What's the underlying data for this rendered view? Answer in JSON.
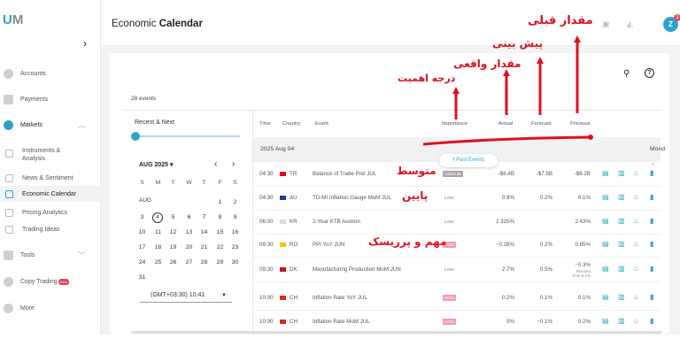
{
  "app": {
    "logo_a": "U",
    "logo_b": "M"
  },
  "header": {
    "title_prefix": "Economic",
    "title_bold": "Calendar",
    "avatar_initial": "Z",
    "notif_count": "1"
  },
  "sidebar": {
    "items": [
      {
        "label": "Accounts"
      },
      {
        "label": "Payments"
      },
      {
        "label": "Markets"
      },
      {
        "label": "Instruments &\nAnalysis"
      },
      {
        "label": "News & Sentiment"
      },
      {
        "label": "Economic Calendar"
      },
      {
        "label": "Pricing Analytics"
      },
      {
        "label": "Trading Ideas"
      },
      {
        "label": "Tools"
      },
      {
        "label": "Copy Trading"
      },
      {
        "label": "More"
      }
    ],
    "new_badge": "New"
  },
  "panel": {
    "events_count": "28 events",
    "recent_label": "Recent & Next",
    "month_label": "AUG 2025",
    "month_short": "AUG",
    "weekdays": [
      "S",
      "M",
      "T",
      "W",
      "T",
      "F",
      "S"
    ],
    "timezone": "(GMT+03:30) 10:41"
  },
  "table": {
    "headers": {
      "time": "Time",
      "country": "Country",
      "event": "Event",
      "importance": "Importance",
      "actual": "Actual",
      "forecast": "Forecast",
      "previous": "Previous"
    },
    "date_label": "2025 Aug 04",
    "next_date_label": "Mond",
    "past_events_label": "Past Events",
    "revised_label": "Revised from",
    "rows": [
      {
        "time": "04:30",
        "country": "TR",
        "event": "Balance of Trade Prel JUL",
        "importance": "MEDIUM",
        "level": "medium",
        "actual": "-$6.4B",
        "forecast": "-$7.5B",
        "previous": "-$8.2B",
        "revised": "",
        "flag": "#e30a17"
      },
      {
        "time": "04:30",
        "country": "AU",
        "event": "TD-MI Inflation Gauge MoM JUL",
        "importance": "LOW",
        "level": "low",
        "actual": "0.9%",
        "forecast": "0.2%",
        "previous": "0.1%",
        "revised": "",
        "flag": "#1d3f8a"
      },
      {
        "time": "06:00",
        "country": "KR",
        "event": "2-Year KTB Auction",
        "importance": "LOW",
        "level": "low",
        "actual": "2.325%",
        "forecast": "",
        "previous": "2.43%",
        "revised": "",
        "flag": "#dcdcdc"
      },
      {
        "time": "09:30",
        "country": "RO",
        "event": "PPI YoY JUN",
        "importance": "HIGH",
        "level": "high",
        "actual": "−0.28%",
        "forecast": "0.2%",
        "previous": "0.85%",
        "revised": "",
        "flag": "#f7c600"
      },
      {
        "time": "09:30",
        "country": "DK",
        "event": "Manufacturing Production MoM JUN",
        "importance": "LOW",
        "level": "low",
        "actual": "2.7%",
        "forecast": "0.5%",
        "previous": "−0.3%",
        "revised": "0.1%",
        "flag": "#c8102e"
      },
      {
        "time": "10:00",
        "country": "CH",
        "event": "Inflation Rate YoY JUL",
        "importance": "HIGH",
        "level": "high",
        "actual": "0.2%",
        "forecast": "0.1%",
        "previous": "0.1%",
        "revised": "",
        "flag": "#d52b1e"
      },
      {
        "time": "10:00",
        "country": "CH",
        "event": "Inflation Rate MoM JUL",
        "importance": "HIGH",
        "level": "high",
        "actual": "0%",
        "forecast": "−0.1%",
        "previous": "0.2%",
        "revised": "",
        "flag": "#d52b1e"
      }
    ]
  },
  "annotations": {
    "previous": "مقدار قبلی",
    "forecast": "پیش بینی",
    "actual": "مقدار واقعی",
    "importance": "درجه اهمیت",
    "medium": "متوسط",
    "low": "پایین",
    "high": "مهم و پرریسک"
  },
  "colors": {
    "accent": "#2ea3c9",
    "annotation_red": "#e0101e",
    "high_badge": "#f29ab0",
    "medium_badge": "#a6a6a6"
  }
}
